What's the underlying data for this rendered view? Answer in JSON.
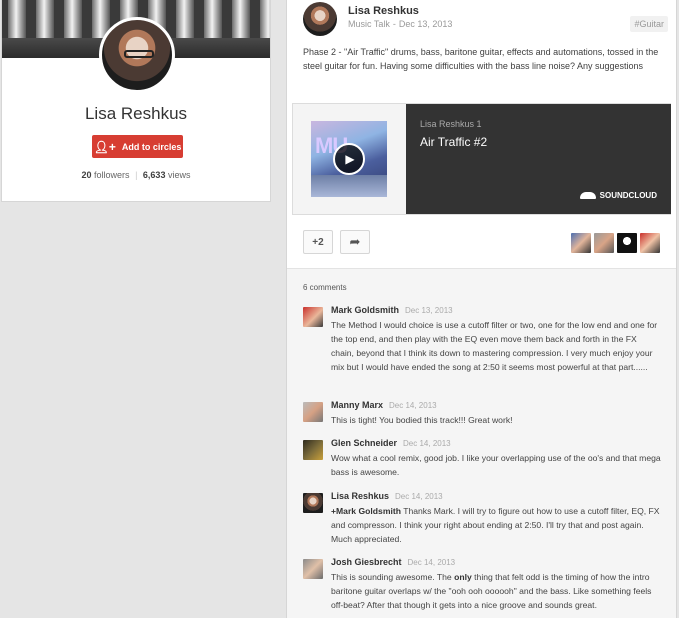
{
  "profile": {
    "name": "Lisa Reshkus",
    "add_button": "Add to circles",
    "followers_count": "20",
    "followers_label": "followers",
    "views_count": "6,633",
    "views_label": "views"
  },
  "post": {
    "author": "Lisa Reshkus",
    "community": "Music Talk",
    "date": "Dec 13, 2013",
    "tag": "#Guitar",
    "text": "Phase 2 - \"Air Traffic\" drums, bass, baritone guitar, effects and automations, tossed in the steel guitar for fun.  Having some difficulties with the bass line noise?  Any suggestions",
    "embed": {
      "user": "Lisa Reshkus 1",
      "title": "Air Traffic #2",
      "brand": "SOUNDCLOUD",
      "thumb_text": "MU"
    },
    "plus_label": "+2"
  },
  "comments": {
    "count_label": "6 comments",
    "items": [
      {
        "name": "Mark Goldsmith",
        "date": "Dec 13, 2013",
        "text": "The Method I would choice is use a cutoff filter or two, one for the low end and one for the top end, and then play with the EQ even move them back and forth in the FX chain, beyond that I think its down to mastering compression. I very much enjoy your mix but I would have ended the song at 2:50 it seems most powerful at that part......"
      },
      {
        "name": "Manny Marx",
        "date": "Dec 14, 2013",
        "text": "This is tight! You bodied this track!!! Great work!"
      },
      {
        "name": "Glen Schneider",
        "date": "Dec 14, 2013",
        "text": "Wow what a cool remix, good job.  I like your overlapping use of the oo's and that mega bass is awesome."
      },
      {
        "name": "Lisa Reshkus",
        "date": "Dec 14, 2013",
        "mention": "+Mark Goldsmith",
        "text": " Thanks Mark.  I will try to figure out how to use a cutoff filter, EQ, FX and compresson.  I think your right about ending at 2:50.  I'll try that and post again.  Much appreciated."
      },
      {
        "name": "Josh Giesbrecht",
        "date": "Dec 14, 2013",
        "text_a": "This is sounding awesome. The ",
        "emphasis": "only",
        "text_b": " thing that felt odd is the timing of how the intro baritone guitar overlaps w/ the \"ooh ooh oooooh\" and the bass. Like something feels off-beat? After that though it gets into a nice groove and sounds great."
      }
    ]
  },
  "colors": {
    "accent_red": "#d73d32",
    "soundcloud_panel": "#333333",
    "background": "#e5e5e5"
  },
  "icons": [
    "add-person-icon",
    "play-icon",
    "soundcloud-icon",
    "share-icon"
  ]
}
